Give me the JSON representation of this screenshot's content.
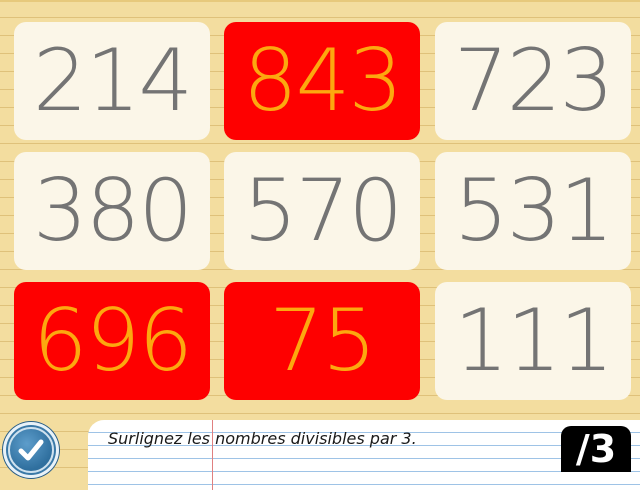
{
  "colors": {
    "tile_normal_bg": "#fbf6e8",
    "tile_normal_text": "#747474",
    "tile_selected_bg": "#fe0000",
    "tile_selected_text": "#fca80f",
    "background": "#f3dd9f",
    "check_button": "#3a79a7"
  },
  "tiles": [
    {
      "value": "214",
      "selected": false
    },
    {
      "value": "843",
      "selected": true
    },
    {
      "value": "723",
      "selected": false
    },
    {
      "value": "380",
      "selected": false
    },
    {
      "value": "570",
      "selected": false
    },
    {
      "value": "531",
      "selected": false
    },
    {
      "value": "696",
      "selected": true
    },
    {
      "value": "75",
      "selected": true
    },
    {
      "value": "111",
      "selected": false
    }
  ],
  "instruction": "Surlignez les nombres divisibles par 3.",
  "counter": "/3",
  "check_icon": "checkmark-icon"
}
